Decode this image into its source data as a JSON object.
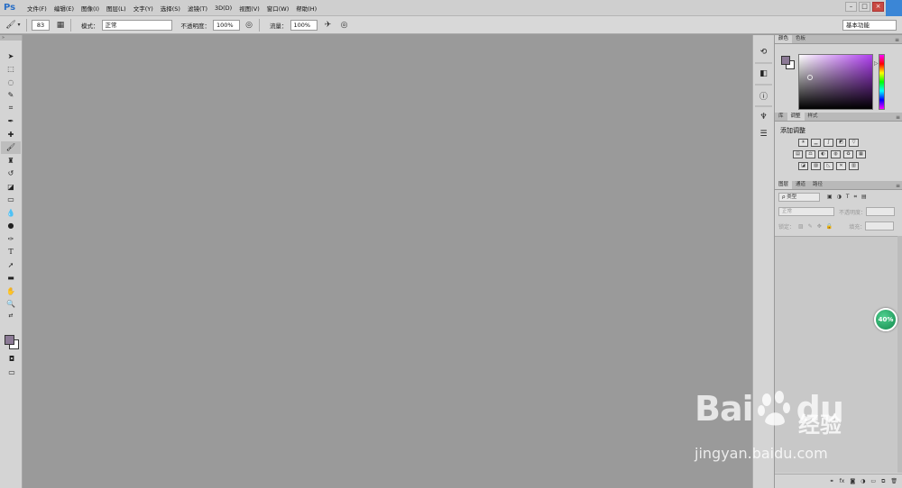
{
  "app": {
    "logo": "Ps"
  },
  "menu": [
    "文件(F)",
    "编辑(E)",
    "图像(I)",
    "图层(L)",
    "文字(Y)",
    "选择(S)",
    "滤镜(T)",
    "3D(D)",
    "视图(V)",
    "窗口(W)",
    "帮助(H)"
  ],
  "options": {
    "brush_size": "83",
    "mode_label": "模式：",
    "mode_value": "正常",
    "opacity_label": "不透明度：",
    "opacity_value": "100%",
    "flow_label": "流量：",
    "flow_value": "100%",
    "workspace": "基本功能"
  },
  "panels": {
    "color_tabs": [
      "颜色",
      "色板"
    ],
    "adj_tabs": [
      "库",
      "调整",
      "样式"
    ],
    "adj_title": "添加调整",
    "layer_tabs": [
      "图层",
      "通道",
      "路径"
    ],
    "kind_filter": "ρ 类型",
    "blend_mode": "正常",
    "opacity_label": "不透明度：",
    "lock_label": "锁定：",
    "fill_label": "填充：",
    "footer_icons": [
      "link-icon",
      "fx-icon",
      "mask-icon",
      "adjustment-icon",
      "folder-icon",
      "new-layer-icon",
      "trash-icon"
    ]
  },
  "colors": {
    "foreground": "#8c7a96",
    "background": "#ffffff",
    "canvas": "#9a9a9a"
  },
  "overlay": {
    "progress": "40%"
  },
  "watermark": {
    "brand": "Bai",
    "brand2": "du",
    "cn": "经验",
    "url": "jingyan.baidu.com"
  }
}
